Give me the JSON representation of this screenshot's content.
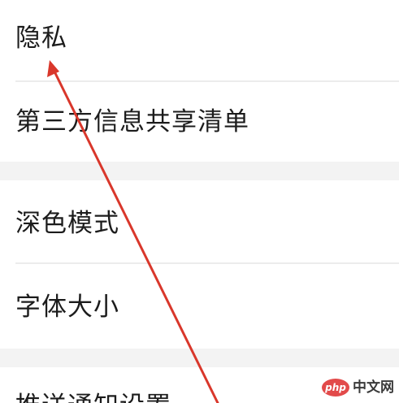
{
  "settings": {
    "items": [
      {
        "label": "隐私"
      },
      {
        "label": "第三方信息共享清单"
      },
      {
        "label": "深色模式"
      },
      {
        "label": "字体大小"
      },
      {
        "label": "推送通知设置"
      }
    ]
  },
  "annotation": {
    "arrow_color": "#d9372b",
    "points_to": "隐私"
  },
  "watermark": {
    "badge_text": "php",
    "site_text": "中文网",
    "badge_color": "#e24a4a"
  },
  "colors": {
    "background": "#f3f3f3",
    "row": "#ffffff",
    "text": "#1c1c1c",
    "divider": "#ececec"
  }
}
